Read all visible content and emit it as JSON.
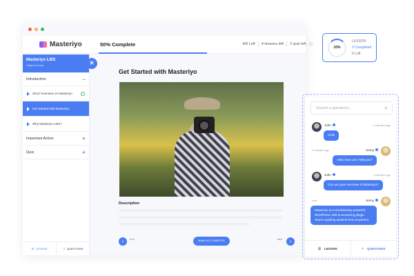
{
  "brand": {
    "name": "Masteriyo"
  },
  "header": {
    "progress_label": "50% Complete",
    "progress_percent": 50,
    "stats": [
      "4/8 Left",
      "4 lessons left",
      "2 quiz left"
    ]
  },
  "tooltip": {
    "percent": "10%",
    "label": "LESSON",
    "completed": "2 Completed",
    "left": "6 Left"
  },
  "sidebar": {
    "course_title": "Masteriyo LMS",
    "back_label": "Back to course",
    "sections": [
      {
        "label": "Introduction",
        "toggle": "−"
      },
      {
        "label": "Important Action",
        "toggle": "+"
      },
      {
        "label": "Quiz",
        "toggle": "+"
      }
    ],
    "lessons": [
      {
        "label": "Short Overview on Masteriyo",
        "completed": true
      },
      {
        "label": "Get Started with Masteriyo",
        "active": true
      },
      {
        "label": "Why Masteriyo LMS?"
      }
    ],
    "footer": {
      "lesson": "LESSON",
      "questions": "QUESTIONS"
    }
  },
  "main": {
    "title": "Get Started with Masteriyo",
    "description_label": "Description",
    "prev": "Prev",
    "next": "Next",
    "mark_complete": "MARK AS COMPLETE"
  },
  "chat": {
    "search_placeholder": "Search a questions...",
    "messages": [
      {
        "name": "John",
        "time": "2 minutes ago",
        "text": "Hello"
      },
      {
        "name": "Jenny",
        "time": "2 minutes ago",
        "text": "Hello how can I help you?"
      },
      {
        "name": "John",
        "time": "1 minutes ago",
        "text": "Can you give overview of Masteriyo?"
      },
      {
        "name": "Jenny",
        "time": "now",
        "text": "Masteriyo is a revolutionary powerful WordPress LMS & eLearning plugin. Teach anything anytime from anywhere."
      }
    ],
    "footer": {
      "lesson": "LESSON",
      "questions": "QUESTIONS"
    }
  },
  "colors": {
    "accent": "#4a7cf2",
    "success": "#3db56b"
  }
}
